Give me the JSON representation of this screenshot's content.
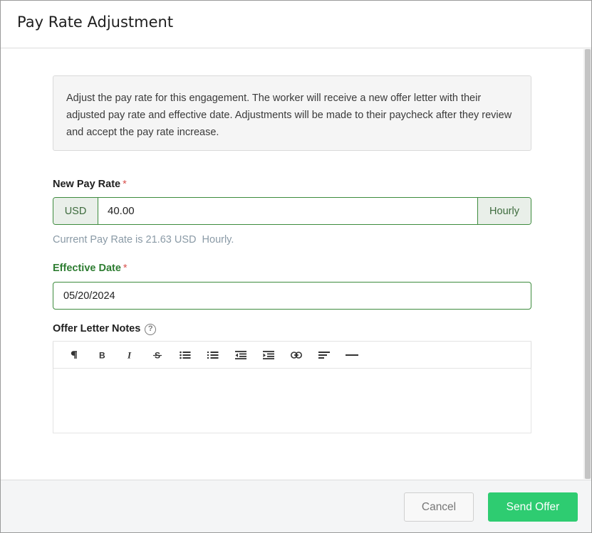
{
  "dialog": {
    "title": "Pay Rate Adjustment",
    "info_text": "Adjust the pay rate for this engagement. The worker will receive a new offer letter with their adjusted pay rate and effective date. Adjustments will be made to their paycheck after they review and accept the pay rate increase."
  },
  "pay_rate": {
    "label": "New Pay Rate",
    "required_mark": "*",
    "currency": "USD",
    "value": "40.00",
    "unit": "Hourly",
    "helper": "Current Pay Rate is 21.63 USD  Hourly."
  },
  "effective_date": {
    "label": "Effective Date",
    "required_mark": "*",
    "value": "05/20/2024"
  },
  "notes": {
    "label": "Offer Letter Notes",
    "help_glyph": "?",
    "value": "",
    "toolbar": [
      {
        "name": "paragraph-icon",
        "glyph": "¶"
      },
      {
        "name": "bold-icon",
        "glyph": "B"
      },
      {
        "name": "italic-icon",
        "glyph": "I"
      },
      {
        "name": "strikethrough-icon",
        "glyph": "S"
      },
      {
        "name": "bullet-list-icon",
        "glyph": "☰"
      },
      {
        "name": "numbered-list-icon",
        "glyph": "☰"
      },
      {
        "name": "outdent-icon",
        "glyph": "☰"
      },
      {
        "name": "indent-icon",
        "glyph": "☰"
      },
      {
        "name": "link-icon",
        "glyph": "⊂⊃"
      },
      {
        "name": "align-left-icon",
        "glyph": "≡"
      },
      {
        "name": "horizontal-rule-icon",
        "glyph": "—"
      }
    ]
  },
  "footer": {
    "cancel_label": "Cancel",
    "send_label": "Send Offer"
  },
  "colors": {
    "accent_green": "#2ecc71",
    "field_border": "#3d8b3d",
    "required": "#d9534f",
    "helper_text": "#8a9aa6"
  }
}
